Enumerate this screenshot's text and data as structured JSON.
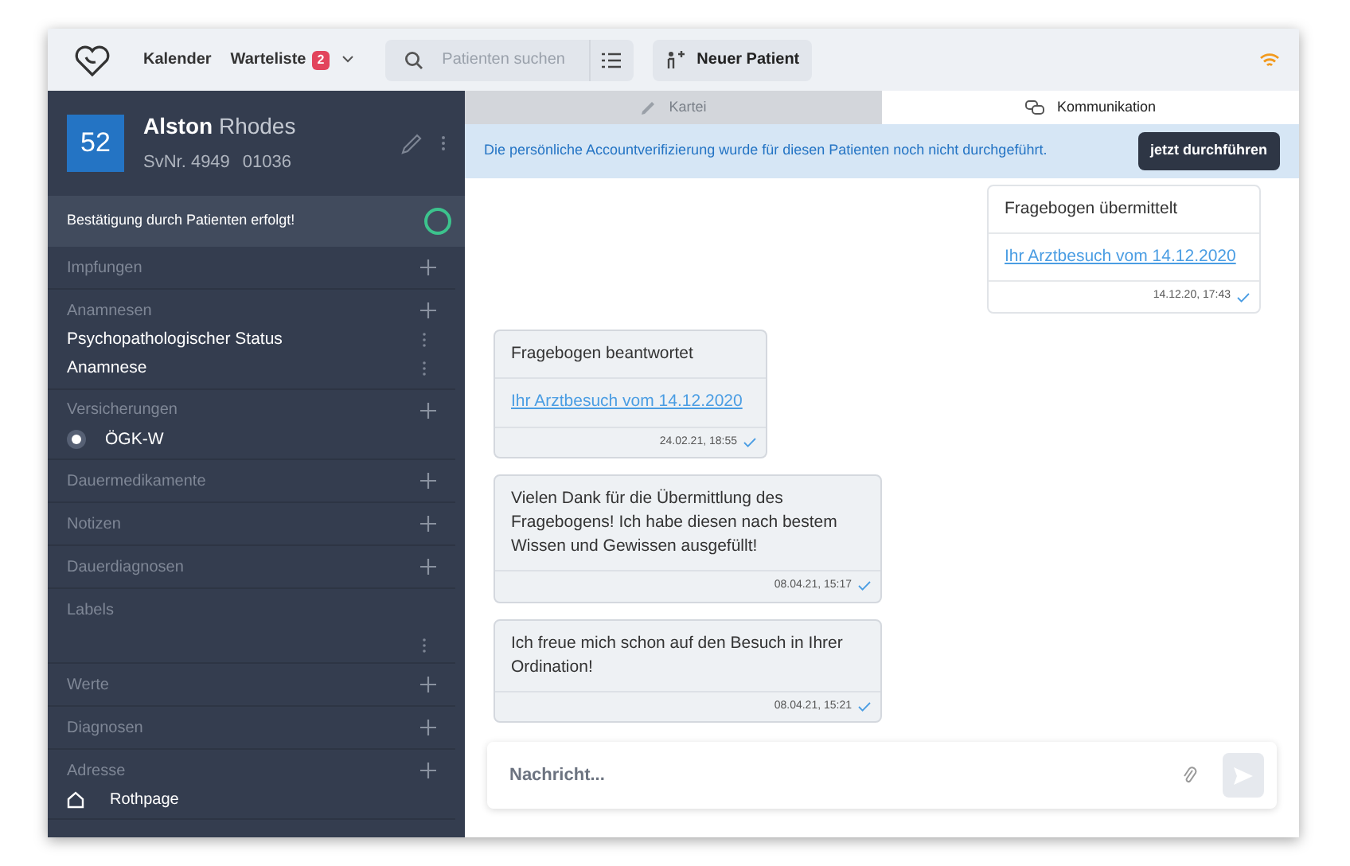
{
  "nav": {
    "items": [
      {
        "label": "Kalender"
      },
      {
        "label": "Warteliste",
        "badge": "2",
        "dropdown": true
      }
    ],
    "search": {
      "placeholder": "Patienten suchen"
    },
    "new_patient": "Neuer Patient"
  },
  "patient": {
    "number": "52",
    "first_name": "Alston",
    "last_name": "Rhodes",
    "svnr": "SvNr. 4949",
    "birth": "01036"
  },
  "confirmation": "Bestätigung durch Patienten erfolgt!",
  "sections": [
    {
      "title": "Impfungen",
      "addable": true
    },
    {
      "title": "Anamnesen",
      "addable": true,
      "items": [
        {
          "kind": "entry",
          "label": "Psychopathologischer Status"
        },
        {
          "kind": "entry",
          "label": "Anamnese"
        }
      ]
    },
    {
      "title": "Versicherungen",
      "addable": true,
      "items": [
        {
          "kind": "radio",
          "label": "ÖGK-W",
          "selected": true
        }
      ]
    },
    {
      "title": "Dauermedikamente",
      "addable": true
    },
    {
      "title": "Notizen",
      "addable": true
    },
    {
      "title": "Dauerdiagnosen",
      "addable": true
    },
    {
      "title": "Labels",
      "addable": false,
      "items": [
        {
          "kind": "menu"
        }
      ]
    },
    {
      "title": "Werte",
      "addable": true
    },
    {
      "title": "Diagnosen",
      "addable": true
    },
    {
      "title": "Adresse",
      "addable": true,
      "items": [
        {
          "kind": "address",
          "label": "Rothpage"
        }
      ]
    }
  ],
  "tabs": [
    {
      "label": "Kartei",
      "selected": false
    },
    {
      "label": "Kommunikation",
      "selected": true
    }
  ],
  "banner": {
    "text": "Die persönliche Accountverifizierung wurde für diesen Patienten noch nicht durchgeführt.",
    "button": "jetzt durchführen"
  },
  "messages": [
    {
      "kind": "sent",
      "text": "Fragebogen übermittelt",
      "link": "Ihr Arztbesuch vom 14.12.2020",
      "time": "14.12.20, 17:43",
      "read": true
    },
    {
      "kind": "received",
      "text": "Fragebogen beantwortet",
      "link": "Ihr Arztbesuch vom 14.12.2020",
      "time": "24.02.21, 18:55",
      "read": true
    },
    {
      "kind": "received",
      "text": "Vielen Dank für die Übermittlung des Fragebogens! Ich habe diesen nach bestem Wissen und Gewissen ausgefüllt!",
      "time": "08.04.21, 15:17",
      "read": true
    },
    {
      "kind": "received",
      "text": "Ich freue mich schon auf den Besuch in Ihrer Ordination!",
      "time": "08.04.21, 15:21",
      "read": true
    }
  ],
  "composer": {
    "placeholder": "Nachricht..."
  }
}
